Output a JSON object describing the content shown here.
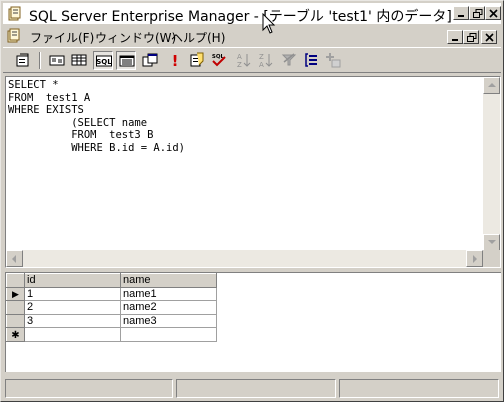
{
  "window": {
    "title": "SQL Server Enterprise Manager - [テーブル 'test1' 内のデータ]"
  },
  "menu": {
    "items": [
      {
        "label": "ファイル(F)"
      },
      {
        "label": "ウィンドウ(W)"
      },
      {
        "label": "ヘルプ(H)"
      }
    ]
  },
  "toolbar": {
    "buttons": [
      {
        "icon": "properties-icon"
      },
      {
        "icon": "diagram-pane-icon"
      },
      {
        "icon": "grid-pane-icon"
      },
      {
        "icon": "sql-pane-icon",
        "label": "SQL",
        "pressed": true
      },
      {
        "icon": "results-pane-icon",
        "pressed": true
      },
      {
        "icon": "change-type-icon"
      },
      {
        "icon": "run-icon",
        "label": "!"
      },
      {
        "icon": "cancel-query-icon"
      },
      {
        "icon": "verify-sql-icon",
        "label": "SQL"
      },
      {
        "icon": "sort-ascending-icon"
      },
      {
        "icon": "sort-descending-icon"
      },
      {
        "icon": "remove-filter-icon"
      },
      {
        "icon": "group-by-icon"
      },
      {
        "icon": "add-table-icon"
      }
    ]
  },
  "sql": {
    "text": "SELECT *\nFROM  test1 A\nWHERE EXISTS\n          (SELECT name\n          FROM  test3 B\n          WHERE B.id = A.id)"
  },
  "results": {
    "columns": [
      "id",
      "name"
    ],
    "rows": [
      {
        "id": "1",
        "name": "name1"
      },
      {
        "id": "2",
        "name": "name2"
      },
      {
        "id": "3",
        "name": "name3"
      }
    ],
    "current_row_marker": "▶",
    "new_row_marker": "✱"
  }
}
